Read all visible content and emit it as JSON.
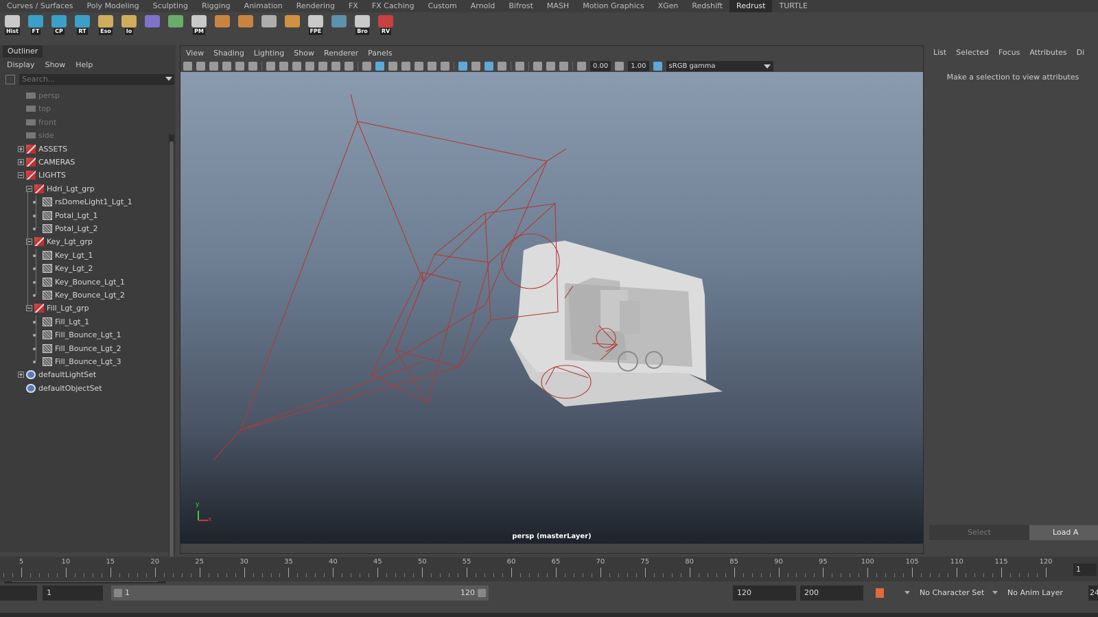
{
  "shelf_tabs": [
    "Curves / Surfaces",
    "Poly Modeling",
    "Sculpting",
    "Rigging",
    "Animation",
    "Rendering",
    "FX",
    "FX Caching",
    "Custom",
    "Arnold",
    "Bifrost",
    "MASH",
    "Motion Graphics",
    "XGen",
    "Redshift",
    "Redrust",
    "TURTLE"
  ],
  "active_shelf_tab": "Redrust",
  "shelf_buttons": [
    {
      "label": "Hist",
      "icon": "history-icon"
    },
    {
      "label": "FT",
      "icon": "freeze-transform-icon"
    },
    {
      "label": "CP",
      "icon": "center-pivot-icon"
    },
    {
      "label": "RT",
      "icon": "reset-transform-icon"
    },
    {
      "label": "Eso",
      "icon": "folder-icon"
    },
    {
      "label": "Io",
      "icon": "folder-open-icon"
    },
    {
      "label": "",
      "icon": "wire-cube-icon"
    },
    {
      "label": "",
      "icon": "uv-grid-icon"
    },
    {
      "label": "PM",
      "icon": "window-icon"
    },
    {
      "label": "",
      "icon": "hand-orange-icon"
    },
    {
      "label": "",
      "icon": "hand-orange-2-icon"
    },
    {
      "label": "",
      "icon": "layout-icon"
    },
    {
      "label": "",
      "icon": "arrows-stack-icon"
    },
    {
      "label": "FPE",
      "icon": "window-blue-icon"
    },
    {
      "label": "",
      "icon": "clapper-icon"
    },
    {
      "label": "Bro",
      "icon": "browser-icon"
    },
    {
      "label": "RV",
      "icon": "redshift-rv-icon"
    }
  ],
  "outliner": {
    "title": "Outliner",
    "menu": [
      "Display",
      "Show",
      "Help"
    ],
    "search_placeholder": "Search...",
    "items": [
      {
        "label": "persp",
        "depth": 0,
        "kind": "camera",
        "dim": true,
        "expander": "none"
      },
      {
        "label": "top",
        "depth": 0,
        "kind": "camera",
        "dim": true,
        "expander": "none"
      },
      {
        "label": "front",
        "depth": 0,
        "kind": "camera",
        "dim": true,
        "expander": "none"
      },
      {
        "label": "side",
        "depth": 0,
        "kind": "camera",
        "dim": true,
        "expander": "none"
      },
      {
        "label": "ASSETS",
        "depth": 0,
        "kind": "group",
        "dim": false,
        "expander": "plus"
      },
      {
        "label": "CAMERAS",
        "depth": 0,
        "kind": "group",
        "dim": false,
        "expander": "plus"
      },
      {
        "label": "LIGHTS",
        "depth": 0,
        "kind": "group",
        "dim": false,
        "expander": "minus"
      },
      {
        "label": "Hdri_Lgt_grp",
        "depth": 1,
        "kind": "group",
        "dim": false,
        "expander": "minus"
      },
      {
        "label": "rsDomeLight1_Lgt_1",
        "depth": 2,
        "kind": "light",
        "dim": false,
        "expander": "none"
      },
      {
        "label": "Potal_Lgt_1",
        "depth": 2,
        "kind": "light",
        "dim": false,
        "expander": "none"
      },
      {
        "label": "Potal_Lgt_2",
        "depth": 2,
        "kind": "light",
        "dim": false,
        "expander": "none"
      },
      {
        "label": "Key_Lgt_grp",
        "depth": 1,
        "kind": "group",
        "dim": false,
        "expander": "minus"
      },
      {
        "label": "Key_Lgt_1",
        "depth": 2,
        "kind": "light",
        "dim": false,
        "expander": "none"
      },
      {
        "label": "Key_Lgt_2",
        "depth": 2,
        "kind": "light",
        "dim": false,
        "expander": "none"
      },
      {
        "label": "Key_Bounce_Lgt_1",
        "depth": 2,
        "kind": "light",
        "dim": false,
        "expander": "none"
      },
      {
        "label": "Key_Bounce_Lgt_2",
        "depth": 2,
        "kind": "light",
        "dim": false,
        "expander": "none"
      },
      {
        "label": "Fill_Lgt_grp",
        "depth": 1,
        "kind": "group",
        "dim": false,
        "expander": "minus"
      },
      {
        "label": "Fill_Lgt_1",
        "depth": 2,
        "kind": "light",
        "dim": false,
        "expander": "none"
      },
      {
        "label": "Fill_Bounce_Lgt_1",
        "depth": 2,
        "kind": "light",
        "dim": false,
        "expander": "none"
      },
      {
        "label": "Fill_Bounce_Lgt_2",
        "depth": 2,
        "kind": "light",
        "dim": false,
        "expander": "none"
      },
      {
        "label": "Fill_Bounce_Lgt_3",
        "depth": 2,
        "kind": "light",
        "dim": false,
        "expander": "none"
      },
      {
        "label": "defaultLightSet",
        "depth": 0,
        "kind": "set",
        "dim": false,
        "expander": "plus"
      },
      {
        "label": "defaultObjectSet",
        "depth": 0,
        "kind": "set",
        "dim": false,
        "expander": "none"
      }
    ]
  },
  "viewport": {
    "menu": [
      "View",
      "Shading",
      "Lighting",
      "Show",
      "Renderer",
      "Panels"
    ],
    "exposure": "0.00",
    "gamma": "1.00",
    "color_space": "sRGB gamma",
    "camera_label": "persp (masterLayer)",
    "axis_y": "y",
    "axis_x": "x"
  },
  "attributes": {
    "tabs": [
      "List",
      "Selected",
      "Focus",
      "Attributes",
      "Di"
    ],
    "message": "Make a selection to view attributes",
    "select_label": "Select",
    "load_label": "Load A"
  },
  "timeline": {
    "labels": [
      "5",
      "10",
      "15",
      "20",
      "25",
      "30",
      "35",
      "40",
      "45",
      "50",
      "55",
      "60",
      "65",
      "70",
      "75",
      "80",
      "85",
      "90",
      "95",
      "100",
      "105",
      "110",
      "115",
      "120"
    ],
    "current_frame": "1"
  },
  "range": {
    "start_field": "1",
    "slider_start": "1",
    "slider_end": "120",
    "end_field": "120",
    "anim_end": "200",
    "character_set": "No Character Set",
    "anim_layer": "No Anim Layer",
    "fps_partial": "24"
  },
  "colors": {
    "active_tab": "#2b2b2b",
    "light_wire": "#b03a36",
    "accent_blue": "#5fa9d6"
  }
}
